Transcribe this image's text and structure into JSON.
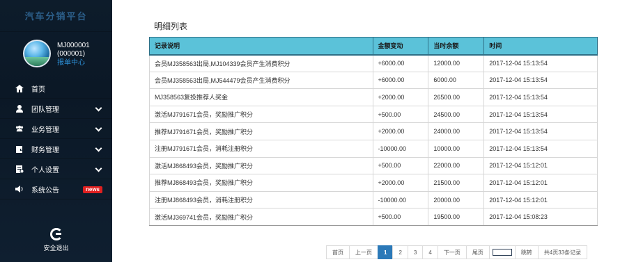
{
  "sidebar": {
    "brand": "汽车分销平台",
    "user_id": "MJ000001",
    "user_code": "(000001)",
    "center_link": "报单中心",
    "menu": [
      {
        "label": "首页",
        "icon": "home-icon",
        "expandable": false
      },
      {
        "label": "团队管理",
        "icon": "user-icon",
        "expandable": true
      },
      {
        "label": "业务管理",
        "icon": "users-icon",
        "expandable": true
      },
      {
        "label": "财务管理",
        "icon": "wallet-icon",
        "expandable": true
      },
      {
        "label": "个人设置",
        "icon": "settings-icon",
        "expandable": true
      },
      {
        "label": "系统公告",
        "icon": "speaker-icon",
        "badge": "news"
      }
    ],
    "logout_label": "安全退出"
  },
  "main": {
    "title": "明细列表",
    "columns": [
      "记录说明",
      "金额变动",
      "当时余额",
      "时间"
    ],
    "rows": [
      [
        "会员MJ358563出局,MJ104339会员产生消费积分",
        "+6000.00",
        "12000.00",
        "2017-12-04 15:13:54"
      ],
      [
        "会员MJ358563出局,MJ544479会员产生消费积分",
        "+6000.00",
        "6000.00",
        "2017-12-04 15:13:54"
      ],
      [
        "MJ358563复投推荐人奖金",
        "+2000.00",
        "26500.00",
        "2017-12-04 15:13:54"
      ],
      [
        "激活MJ791671会员，奖励推广积分",
        "+500.00",
        "24500.00",
        "2017-12-04 15:13:54"
      ],
      [
        "推荐MJ791671会员，奖励推广积分",
        "+2000.00",
        "24000.00",
        "2017-12-04 15:13:54"
      ],
      [
        "注册MJ791671会员，消耗注册积分",
        "-10000.00",
        "10000.00",
        "2017-12-04 15:13:54"
      ],
      [
        "激活MJ868493会员，奖励推广积分",
        "+500.00",
        "22000.00",
        "2017-12-04 15:12:01"
      ],
      [
        "推荐MJ868493会员，奖励推广积分",
        "+2000.00",
        "21500.00",
        "2017-12-04 15:12:01"
      ],
      [
        "注册MJ868493会员，消耗注册积分",
        "-10000.00",
        "20000.00",
        "2017-12-04 15:12:01"
      ],
      [
        "激活MJ369741会员，奖励推广积分",
        "+500.00",
        "19500.00",
        "2017-12-04 15:08:23"
      ]
    ]
  },
  "pager": {
    "first": "首页",
    "prev": "上一页",
    "pages": [
      "1",
      "2",
      "3",
      "4"
    ],
    "current": "1",
    "next": "下一页",
    "last": "尾页",
    "jump": "跳转",
    "info": "共4页33条记录"
  },
  "colors": {
    "header_bg": "#5bc2d9",
    "sidebar_bg": "#0d1c2b",
    "active_page": "#2b79b8",
    "badge": "#e02020"
  }
}
